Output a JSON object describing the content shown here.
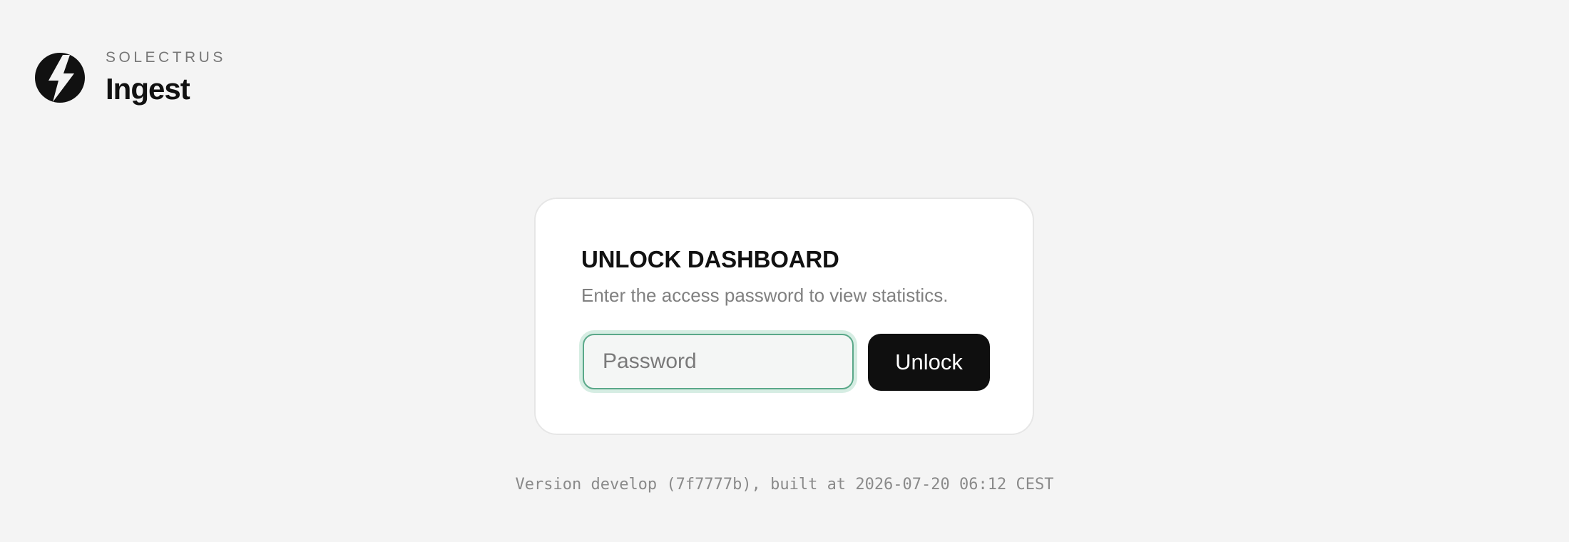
{
  "brand": {
    "kicker": "SOLECTRUS",
    "title": "Ingest",
    "logo_icon": "lightning-bolt-icon"
  },
  "card": {
    "title": "UNLOCK DASHBOARD",
    "subtitle": "Enter the access password to view statistics.",
    "password": {
      "value": "",
      "placeholder": "Password"
    },
    "unlock_label": "Unlock"
  },
  "footer": {
    "version": "Version develop (7f7777b), built at 2026-07-20 06:12 CEST"
  },
  "colors": {
    "background": "#f4f4f4",
    "card": "#ffffff",
    "focus_ring": "#5aa889",
    "button": "#0f0f0f"
  }
}
